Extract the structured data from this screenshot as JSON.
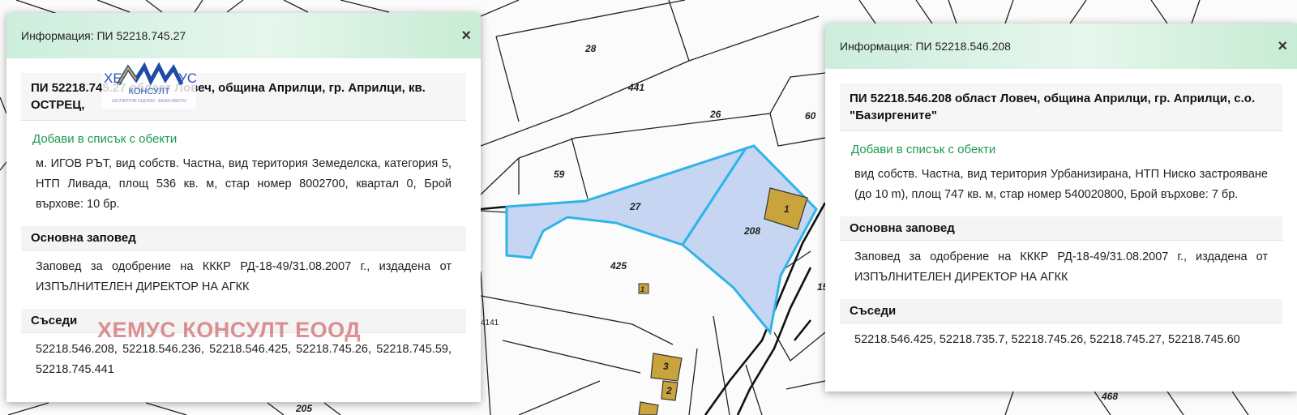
{
  "map": {
    "parcel_labels": [
      "28",
      "441",
      "26",
      "60",
      "59",
      "27",
      "208",
      "1",
      "425",
      "1",
      "15",
      "3",
      "2",
      "4141",
      "205",
      "468"
    ],
    "colors": {
      "selection_fill": "#c6d6f2",
      "selection_stroke": "#2fb4e8",
      "building_fill": "#c9a33c",
      "line": "#222222"
    }
  },
  "left_panel": {
    "header_title": "Информация: ПИ 52218.745.27",
    "close_label": "×",
    "title_text": "ПИ 52218.745.27 област Ловеч, община Априлци, гр. Априлци, кв. ОСТРЕЦ,",
    "add_link": "Добави в списък с обекти",
    "description": "м. ИГОВ РЪТ, вид собств. Частна, вид територия Земеделска, категория 5, НТП Ливада, площ 536 кв. м, стар номер 8002700, квартал 0, Брой върхове: 10 бр.",
    "order_heading": "Основна заповед",
    "order_text": "Заповед за одобрение на КККР РД-18-49/31.08.2007 г., издадена от ИЗПЪЛНИТЕЛЕН ДИРЕКТОР НА АГКК",
    "neighbors_heading": "Съседи",
    "neighbors_text": "52218.546.208, 52218.546.236, 52218.546.425, 52218.745.26, 52218.745.59, 52218.745.441"
  },
  "right_panel": {
    "header_title": "Информация: ПИ 52218.546.208",
    "close_label": "×",
    "title_text": "ПИ 52218.546.208 област Ловеч, община Априлци, гр. Априлци, с.о. \"Базиргените\"",
    "add_link": "Добави в списък с обекти",
    "description": "вид собств. Частна, вид територия Урбанизирана, НТП Ниско застрояване (до 10 m), площ 747 кв. м, стар номер 540020800, Брой върхове: 7 бр.",
    "order_heading": "Основна заповед",
    "order_text": "Заповед за одобрение на КККР РД-18-49/31.08.2007 г., издадена от ИЗПЪЛНИТЕЛЕН ДИРЕКТОР НА АГКК",
    "neighbors_heading": "Съседи",
    "neighbors_text": "52218.546.425, 52218.735.7, 52218.745.26, 52218.745.27, 52218.745.60"
  },
  "watermark": {
    "text": "ХЕМУС КОНСУЛТ ЕООД",
    "logo_top": "ХЕ",
    "logo_right": "УС",
    "logo_word": "КОНСУЛТ",
    "logo_tag": "ЕКСПЕРТНИ ОЦЕНКИ · ВАШИ ИМОТИ"
  }
}
